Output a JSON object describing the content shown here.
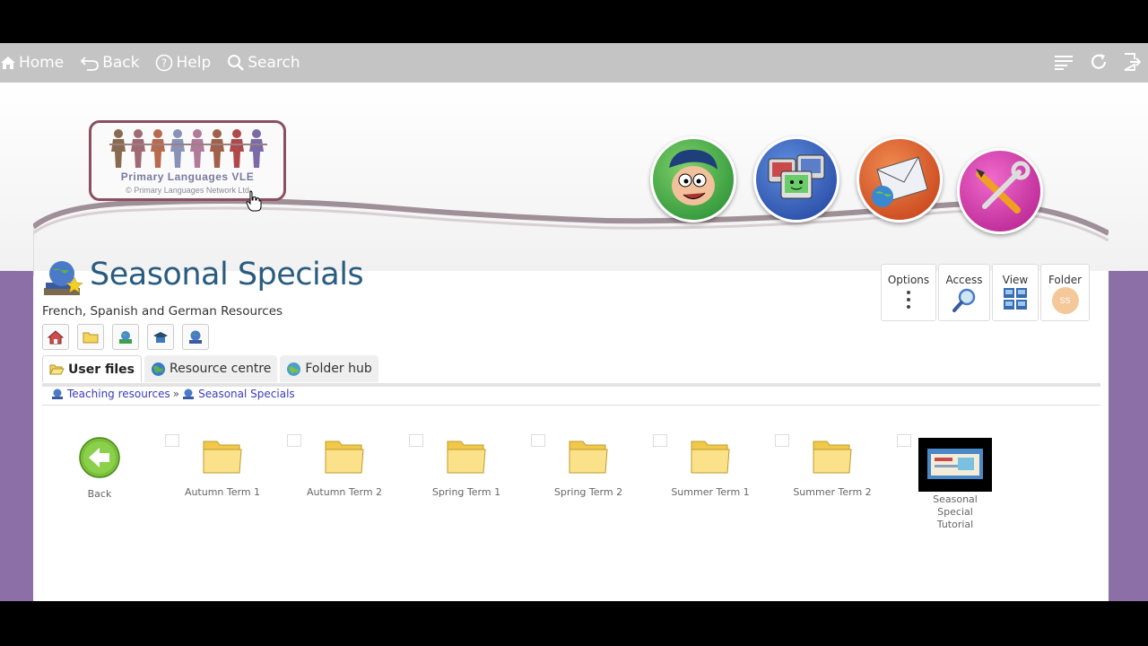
{
  "toolbar": {
    "home": "Home",
    "back": "Back",
    "help": "Help",
    "search": "Search"
  },
  "logo": {
    "title": "Primary Languages VLE",
    "copyright": "© Primary Languages Network Ltd"
  },
  "page": {
    "title": "Seasonal Specials",
    "subtitle": "French, Spanish and German Resources"
  },
  "options": {
    "options_label": "Options",
    "access_label": "Access",
    "view_label": "View",
    "folder_label": "Folder",
    "folder_badge": "SS"
  },
  "tabs": [
    {
      "label": "User files"
    },
    {
      "label": "Resource centre"
    },
    {
      "label": "Folder hub"
    }
  ],
  "breadcrumb": {
    "items": [
      "Teaching resources",
      "Seasonal Specials"
    ],
    "separator": "»"
  },
  "files": [
    {
      "label": "Back"
    },
    {
      "label": "Autumn Term 1"
    },
    {
      "label": "Autumn Term 2"
    },
    {
      "label": "Spring Term 1"
    },
    {
      "label": "Spring Term 2"
    },
    {
      "label": "Summer Term 1"
    },
    {
      "label": "Summer Term 2"
    },
    {
      "label": "Seasonal Special Tutorial"
    }
  ],
  "colors": {
    "toolbar": "#c4c4c4",
    "purple": "#8b6fa6",
    "title": "#2a5c80",
    "link": "#3b3bb8"
  }
}
